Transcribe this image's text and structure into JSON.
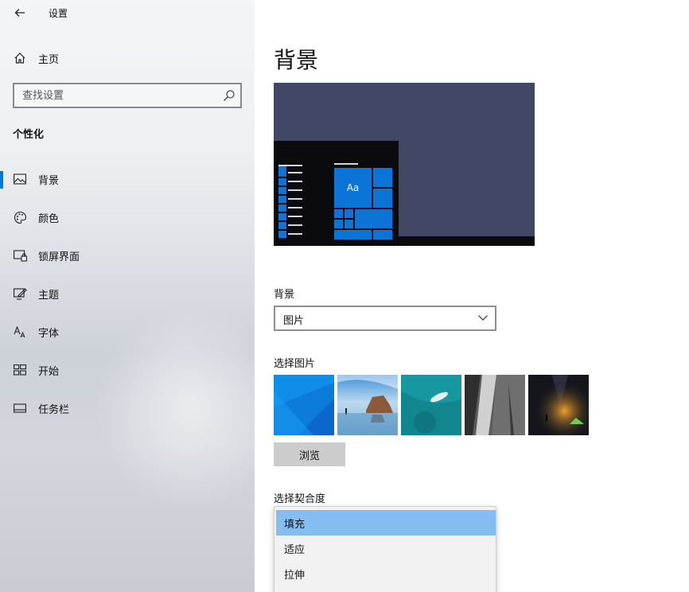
{
  "window": {
    "title": "设置"
  },
  "sidebar": {
    "home_label": "主页",
    "search_placeholder": "查找设置",
    "section_title": "个性化",
    "items": [
      {
        "label": "背景",
        "icon": "picture-icon",
        "active": true
      },
      {
        "label": "颜色",
        "icon": "palette-icon",
        "active": false
      },
      {
        "label": "锁屏界面",
        "icon": "lock-screen-icon",
        "active": false
      },
      {
        "label": "主题",
        "icon": "theme-brush-icon",
        "active": false
      },
      {
        "label": "字体",
        "icon": "font-icon",
        "active": false
      },
      {
        "label": "开始",
        "icon": "start-grid-icon",
        "active": false
      },
      {
        "label": "任务栏",
        "icon": "taskbar-icon",
        "active": false
      }
    ]
  },
  "main": {
    "title": "背景",
    "preview": {
      "tile_text": "Aa",
      "background_color": "#414765",
      "accent_color": "#0b74d6"
    },
    "background_label": "背景",
    "background_value": "图片",
    "choose_picture_label": "选择图片",
    "browse_label": "浏览",
    "fit_label": "选择契合度",
    "fit_options": [
      {
        "label": "填充",
        "selected": true
      },
      {
        "label": "适应",
        "selected": false
      },
      {
        "label": "拉伸",
        "selected": false
      }
    ]
  }
}
